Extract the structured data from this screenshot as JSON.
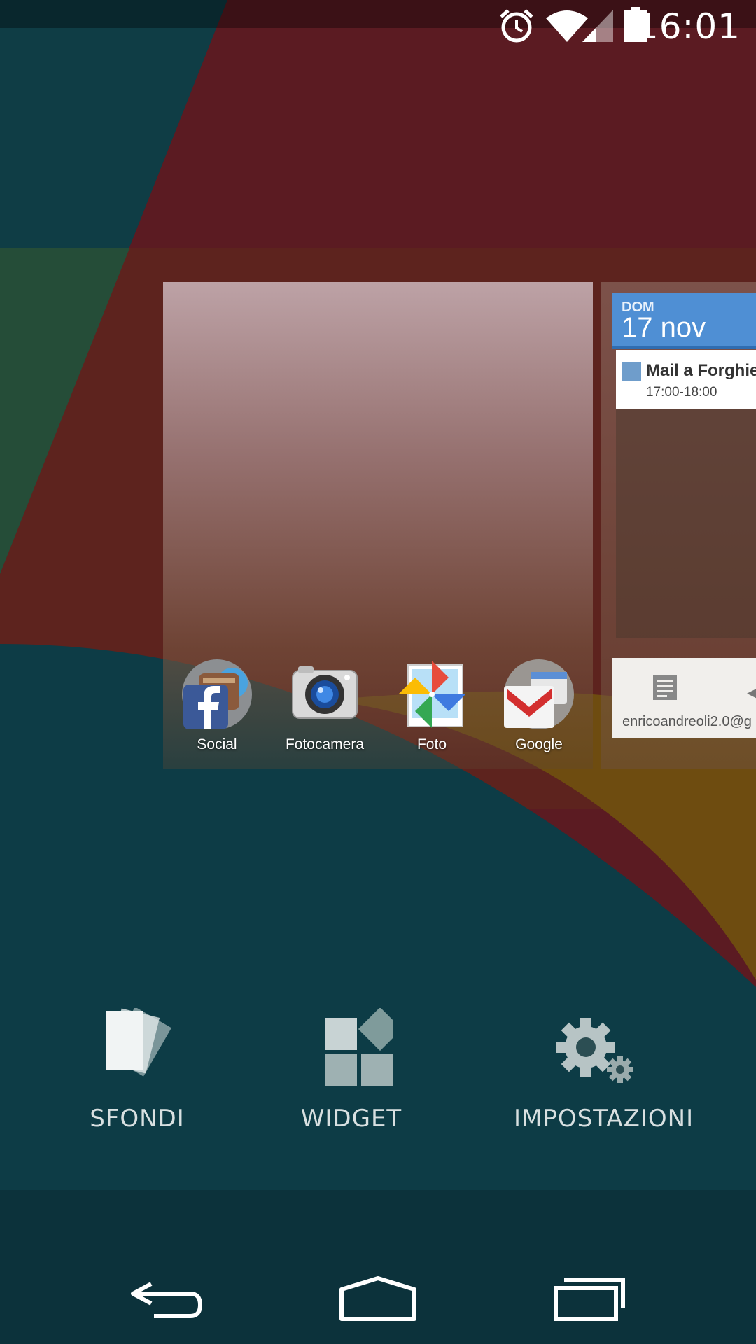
{
  "status_bar": {
    "time": "16:01",
    "icons": [
      "alarm-icon",
      "wifi-icon",
      "signal-icon",
      "battery-icon"
    ]
  },
  "calendar_widget": {
    "day_of_week": "DOM",
    "date": "17 nov",
    "event_title": "Mail a Forghie",
    "event_time": "17:00-18:00",
    "accent_color": "#4f8fd4"
  },
  "gmail_widget": {
    "account": "enricoandreoli2.0@g"
  },
  "dock_apps": [
    {
      "label": "Social",
      "icon": "social-folder-icon"
    },
    {
      "label": "Fotocamera",
      "icon": "camera-icon"
    },
    {
      "label": "Foto",
      "icon": "photos-pinwheel-icon"
    },
    {
      "label": "Google",
      "icon": "google-folder-icon"
    }
  ],
  "overview_options": [
    {
      "label": "SFONDI",
      "icon": "wallpapers-icon"
    },
    {
      "label": "WIDGET",
      "icon": "widgets-icon"
    },
    {
      "label": "IMPOSTAZIONI",
      "icon": "settings-icon"
    }
  ],
  "nav_bar": {
    "buttons": [
      "back-icon",
      "home-icon",
      "recents-icon"
    ]
  }
}
